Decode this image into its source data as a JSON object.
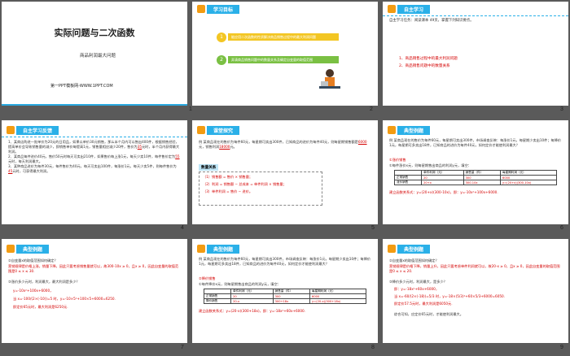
{
  "slide_numbers": [
    "1",
    "2",
    "3",
    "4",
    "5",
    "6",
    "7",
    "8",
    "9"
  ],
  "s1": {
    "title": "实际问题与二次函数",
    "subtitle": "商品利润最大问题",
    "footer": "第一PPT模板网-WWW.1PPT.COM"
  },
  "s2": {
    "header": "学习目标",
    "goal1": "能应用二次函数的性质解决商品销售过程中的最大利润问题",
    "goal2": "弄清商品销售问题中的数量关系及确定自变量的取值范围",
    "n1": "1",
    "n2": "2"
  },
  "s3": {
    "header": "自主学习",
    "task": "自主学习任务：阅读课本 49页，掌握下列知识要点。",
    "item1": "1、商品销售过程中的最大利润问题",
    "item2": "2、商品销售问题中的数量关系"
  },
  "s4": {
    "header": "自主学习反馈",
    "p1": "1、某商店购进一批单价为20元的日用品，如果以单价30元销售，那么半个月内可以售出400件，根据销售经验，提高单价会导致销售量的减少，即销售单价每提高1元，销售量相应减少20件，售价为",
    "a1": "35",
    "p1b": "元时，半个月内获得最大利润。",
    "p2": "2、某商品每件进价40元，售价50元时每天可卖出210件，如果售价每上涨1元，每天少卖10件，每件售价定为",
    "a2": "55",
    "p2b": "元时，每天利润最大。",
    "p3": "3、某种商品进价为每件30元，每件售价为40元，每天可卖出100件，每涨价1元，每天少卖5件，则每件售价为",
    "a3": "45",
    "p3b": "元时，可获得最大利润。"
  },
  "s5": {
    "header": "课堂探究",
    "q": "例  某商品现在的售价为每件60元，每星期可卖出300件，已知商品的进价为每件40元，则每星期销售额是",
    "a1": "18000",
    "mid": "元，销售利润",
    "a2": "6000",
    "end": "元。",
    "box": "数量关系",
    "r1": "（1）销售额 = 售价 × 销售量；",
    "r2": "（2）利润 = 销售额 − 总成本 = 单件利润 × 销售量；",
    "r3": "（3）单件利润 = 售价 − 进价。"
  },
  "s6": {
    "header": "典型例题",
    "q": "例  某商品现在的售价为每件60元，每星期可卖出300件，市场调查反映：每涨价1元，每星期少卖出10件；每降价1元，每星期可多卖出18件，已知商品的进价为每件40元，如何定价才能使利润最大？",
    "sub": "①涨价销售",
    "t1": "①每件涨价x元，则每星期售出商品的利润y元，填空：",
    "cols": [
      "",
      "单件利润（元）",
      "销售量（件）",
      "每星期利润（元）"
    ],
    "row1": [
      "正常销售",
      "20",
      "300",
      "6000"
    ],
    "row2": [
      "涨价销售",
      "20+x",
      "300-10x",
      "y=(20+x)(300-10x)"
    ],
    "rel": "建立函数关系式：y=(20+x)(300-10x)，即：y=-10x²+100x+6000."
  },
  "s7": {
    "header": "典型例题",
    "q": "②自变量x的取值范围如何确定？",
    "a": "营销规律是价格上涨，销量下降，因此只要考虑销售量就可以，故300-10x ≥ 0，且x ≥ 0，因此自变量的取值范围是0 ≤ x ≤ 30.",
    "q2": "③涨价多少元时，利润最大，最大利润是多少？",
    "s1": "y=-10x²+100x+6000，",
    "s2": "当 x=-100/(2×(-10))=5 时，y=-10×5²+100×5+6000=6250.",
    "s3": "即定价65元时，最大利润是6250元."
  },
  "s8": {
    "header": "典型例题",
    "q": "例  某商品现在的售价为每件60元，每星期可卖出300件，市场调查反映：每涨价1元，每星期少卖出10件；每降价1元，每星期可多卖出18件，已知商品的进价为每件40元，如何定价才能使利润最大？",
    "sub": "②降价销售",
    "t1": "①每件降价x元，则每星期售出商品的利润y元，填空：",
    "cols": [
      "",
      "单件利润（元）",
      "销售量（件）",
      "每星期利润（元）"
    ],
    "row1": [
      "正常销售",
      "20",
      "300",
      "6000"
    ],
    "row2": [
      "降价销售",
      "20-x",
      "300+18x",
      "y=(20-x)(300+18x)"
    ],
    "rel": "建立函数关系式：y=(20-x)(300+18x)，即：y=-18x²+60x+6000."
  },
  "s9": {
    "header": "典型例题",
    "q": "②自变量x的取值范围如何确定？",
    "a": "营销规律是价格下降，销量上升，因此只要考虑单件利润就可以，故20-x ≥ 0，且x ≥ 0，因此自变量的取值范围是0 ≤ x ≤ 20.",
    "q2": "③降价多少元时，利润最大，是多少？",
    "s1": "即：y=-18x²+60x+6000，",
    "s2": "当 x=-60/(2×(-18))=5/3 时，y=-18×(5/3)²+60×5/3+6000=6050.",
    "s3": "即定价57.5元时，最大利润是6050元.",
    "s4": "综合可知，应定价65元时，才能使利润最大。"
  }
}
